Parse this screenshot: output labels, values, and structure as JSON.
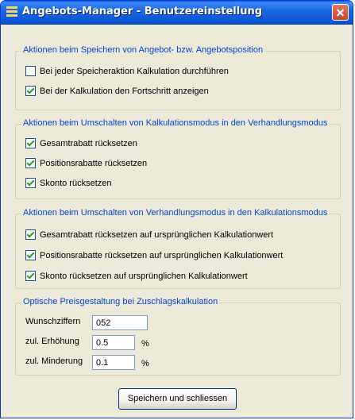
{
  "window": {
    "title": "Angebots-Manager - Benutzereinstellung"
  },
  "groups": [
    {
      "legend": "Aktionen beim Speichern von Angebot- bzw. Angebotsposition",
      "items": [
        {
          "label": "Bei jeder Speicheraktion Kalkulation durchführen",
          "checked": false
        },
        {
          "label": "Bei der Kalkulation den Fortschritt anzeigen",
          "checked": true
        }
      ]
    },
    {
      "legend": "Aktionen beim Umschalten von Kalkulationsmodus in den Verhandlungsmodus",
      "items": [
        {
          "label": "Gesamtrabatt rücksetzen",
          "checked": true
        },
        {
          "label": "Positionsrabatte rücksetzen",
          "checked": true
        },
        {
          "label": "Skonto rücksetzen",
          "checked": true
        }
      ]
    },
    {
      "legend": "Aktionen beim Umschalten von Verhandlungsmodus in den Kalkulationsmodus",
      "items": [
        {
          "label": "Gesamtrabatt rücksetzen auf ursprünglichen Kalkulationwert",
          "checked": true
        },
        {
          "label": "Positionsrabatte rücksetzen  auf ursprünglichen Kalkulationwert",
          "checked": true
        },
        {
          "label": "Skonto rücksetzen  auf ursprünglichen Kalkulationwert",
          "checked": true
        }
      ]
    },
    {
      "legend": "Optische Preisgestaltung bei Zuschlagskalkulation",
      "fields": [
        {
          "label": "Wunschziffern",
          "value": "052",
          "unit": ""
        },
        {
          "label": "zul. Erhöhung",
          "value": "0.5",
          "unit": "%"
        },
        {
          "label": "zul. Minderung",
          "value": "0.1",
          "unit": "%"
        }
      ]
    }
  ],
  "buttons": {
    "save_close": "Speichern und schliessen"
  },
  "colors": {
    "title_bar": "#0a5ce4",
    "legend": "#0046d5",
    "checkmark": "#21a121",
    "close_button": "#c8452c"
  }
}
